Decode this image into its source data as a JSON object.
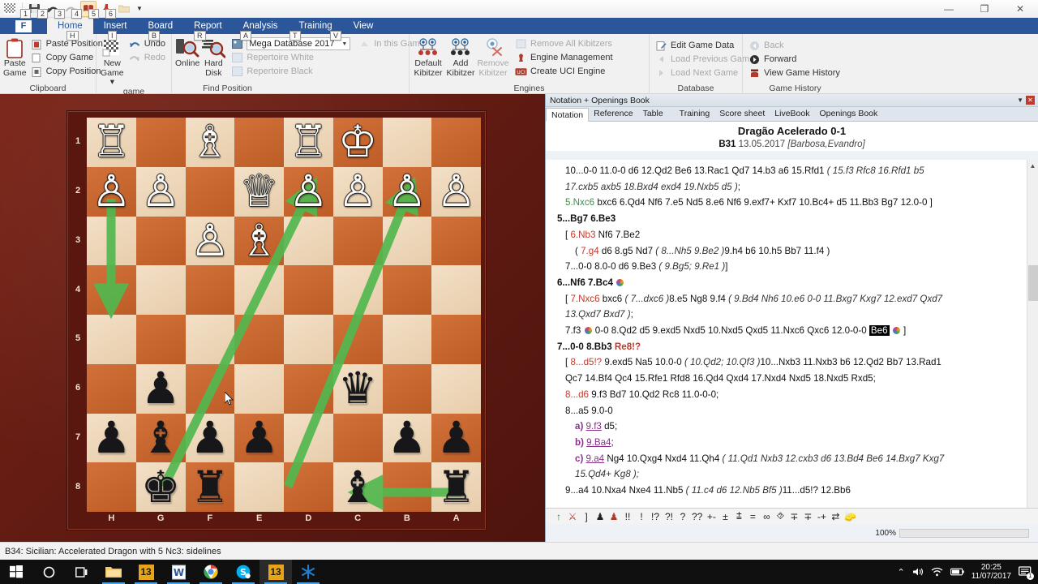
{
  "window": {
    "quick_access": [
      "board-icon",
      "save-icon",
      "undo-icon",
      "redo-icon",
      "book-icon",
      "pin-icon",
      "folder-icon"
    ],
    "quick_access_keytips": [
      "1",
      "2",
      "3",
      "4",
      "5",
      "6"
    ],
    "minimize": "—",
    "maximize": "❐",
    "close": "✕"
  },
  "ribbon": {
    "file_tab": "F",
    "tabs": [
      {
        "label": "Home",
        "keytip": "H",
        "active": true
      },
      {
        "label": "Insert",
        "keytip": "I",
        "active": false
      },
      {
        "label": "Board",
        "keytip": "B",
        "active": false
      },
      {
        "label": "Report",
        "keytip": "R",
        "active": false
      },
      {
        "label": "Analysis",
        "keytip": "A",
        "active": false
      },
      {
        "label": "Training",
        "keytip": "T",
        "active": false
      },
      {
        "label": "View",
        "keytip": "V",
        "active": false
      }
    ],
    "groups": [
      {
        "title": "Clipboard",
        "big": [
          {
            "label_line1": "Paste",
            "label_line2": "Game",
            "icon": "clipboard-icon"
          }
        ],
        "small": [
          {
            "label": "Paste Position",
            "icon": "paste-position-icon",
            "disabled": false
          },
          {
            "label": "Copy Game",
            "icon": "copy-game-icon",
            "disabled": false
          },
          {
            "label": "Copy Position",
            "icon": "copy-position-icon",
            "disabled": false
          }
        ]
      },
      {
        "title": "game",
        "big": [
          {
            "label_line1": "New",
            "label_line2": "Game ▾",
            "icon": "new-game-icon"
          }
        ],
        "small": [
          {
            "label": "Undo",
            "icon": "undo-icon",
            "disabled": false
          },
          {
            "label": "Redo",
            "icon": "redo-icon",
            "disabled": true
          }
        ]
      },
      {
        "title": "Find Position",
        "big": [
          {
            "label_line1": "Online",
            "label_line2": "",
            "icon": "online-search-icon"
          },
          {
            "label_line1": "Hard",
            "label_line2": "Disk",
            "icon": "harddisk-search-icon"
          }
        ],
        "combo": {
          "value": "Mega Database 2017",
          "icon": "database-icon"
        },
        "small": [
          {
            "label": "Repertoire White",
            "icon": "repertoire-white-icon",
            "disabled": true
          },
          {
            "label": "Repertoire Black",
            "icon": "repertoire-black-icon",
            "disabled": true
          },
          {
            "label": "In this Game",
            "icon": "in-this-game-icon",
            "disabled": true
          }
        ]
      },
      {
        "title": "Engines",
        "big": [
          {
            "label_line1": "Default",
            "label_line2": "Kibitzer",
            "icon": "default-kibitzer-icon"
          },
          {
            "label_line1": "Add",
            "label_line2": "Kibitzer",
            "icon": "add-kibitzer-icon"
          },
          {
            "label_line1": "Remove",
            "label_line2": "Kibitzer",
            "icon": "remove-kibitzer-icon",
            "disabled": true
          }
        ],
        "small": [
          {
            "label": "Remove All Kibitzers",
            "icon": "remove-all-kibitzers-icon",
            "disabled": true
          },
          {
            "label": "Engine Management",
            "icon": "engine-management-icon",
            "disabled": false
          },
          {
            "label": "Create UCI Engine",
            "icon": "create-uci-engine-icon",
            "disabled": false
          }
        ]
      },
      {
        "title": "Database",
        "small": [
          {
            "label": "Edit Game Data",
            "icon": "edit-game-data-icon",
            "disabled": false
          },
          {
            "label": "Load Previous Game",
            "icon": "load-previous-game-icon",
            "disabled": true
          },
          {
            "label": "Load Next Game",
            "icon": "load-next-game-icon",
            "disabled": true
          }
        ]
      },
      {
        "title": "Game History",
        "small": [
          {
            "label": "Back",
            "icon": "back-icon",
            "disabled": true
          },
          {
            "label": "Forward",
            "icon": "forward-icon",
            "disabled": false
          },
          {
            "label": "View Game History",
            "icon": "view-game-history-icon",
            "disabled": false
          }
        ]
      }
    ]
  },
  "board": {
    "orientation": "black-bottom-flipped",
    "rank_labels": [
      "1",
      "2",
      "3",
      "4",
      "5",
      "6",
      "7",
      "8"
    ],
    "file_labels": [
      "H",
      "G",
      "F",
      "E",
      "D",
      "C",
      "B",
      "A"
    ],
    "squares": [
      [
        "wR",
        "",
        "wB",
        "",
        "wR",
        "wK",
        "",
        ""
      ],
      [
        "wP",
        "wP",
        "",
        "wQ",
        "wP",
        "wP",
        "wP",
        "wP"
      ],
      [
        "",
        "",
        "wP",
        "wB",
        "",
        "",
        "",
        ""
      ],
      [
        "",
        "",
        "",
        "",
        "",
        "",
        "",
        ""
      ],
      [
        "",
        "",
        "",
        "",
        "",
        "",
        "",
        ""
      ],
      [
        "",
        "bP",
        "",
        "",
        "",
        "bQ",
        "",
        ""
      ],
      [
        "bP",
        "bB",
        "bP",
        "bP",
        "",
        "",
        "bP",
        "bP"
      ],
      [
        "",
        "bK",
        "bR",
        "",
        "",
        "bB",
        "",
        "bR"
      ]
    ],
    "arrows": [
      {
        "from": "h2",
        "to": "h4",
        "color": "#5cb85c",
        "label": "arrow-green-down-left-file"
      },
      {
        "from": "g7",
        "to": "b2",
        "color": "#5cb85c",
        "label": "arrow-green-long-diagonal-1"
      },
      {
        "from": "c6",
        "to": "a2",
        "color": "#5cb85c",
        "label": "arrow-green-long-diagonal-2"
      },
      {
        "from": "a8",
        "to": "c8",
        "color": "#5cb85c",
        "label": "arrow-green-rook-to-bishop"
      }
    ],
    "colors": {
      "light": "#efd9be",
      "dark": "#c8682f",
      "frame": "#5a1710"
    }
  },
  "notation_panel": {
    "caption": "Notation + Openings Book",
    "caption_buttons": [
      "chevron-down-icon",
      "close-icon"
    ],
    "tabs": [
      {
        "label": "Notation",
        "active": true
      },
      {
        "label": "Reference",
        "active": false
      },
      {
        "label": "Table",
        "active": false
      },
      {
        "label": "Training",
        "active": false
      },
      {
        "label": "Score sheet",
        "active": false
      },
      {
        "label": "LiveBook",
        "active": false
      },
      {
        "label": "Openings Book",
        "active": false
      }
    ],
    "game_title": "Dragão Acelerado  0-1",
    "eco": "B31",
    "date": "13.05.2017",
    "players": "[Barbosa,Evandro]",
    "lines": [
      {
        "indent": 1,
        "segments": [
          {
            "t": "10...0-0  11.0-0  d6  12.Qd2  Be6  13.Rac1  Qd7  14.b3  a6  15.Rfd1  ",
            "c": "plain"
          },
          {
            "t": "( 15.f3  Rfc8  16.Rfd1  b5",
            "c": "ital"
          }
        ]
      },
      {
        "indent": 1,
        "segments": [
          {
            "t": "17.cxb5  axb5  18.Bxd4  exd4  19.Nxb5  d5 )",
            "c": "ital"
          },
          {
            "t": ";",
            "c": "plain"
          }
        ]
      },
      {
        "indent": 1,
        "segments": [
          {
            "t": "5.Nxc6",
            "c": "green"
          },
          {
            "t": "  bxc6  6.Qd4  Nf6  7.e5  Nd5  8.e6  Nf6  9.exf7+  Kxf7  10.Bc4+  d5  11.Bb3  Bg7  12.0-0 ]",
            "c": "plain"
          }
        ]
      },
      {
        "indent": 0,
        "segments": [
          {
            "t": "5...Bg7  6.Be3",
            "c": "bold"
          }
        ]
      },
      {
        "indent": 1,
        "segments": [
          {
            "t": "[ ",
            "c": "plain"
          },
          {
            "t": "6.Nb3",
            "c": "red"
          },
          {
            "t": "  Nf6  7.Be2",
            "c": "plain"
          }
        ]
      },
      {
        "indent": 2,
        "segments": [
          {
            "t": "( ",
            "c": "plain"
          },
          {
            "t": "7.g4",
            "c": "red"
          },
          {
            "t": "  d6  8.g5  Nd7  ",
            "c": "plain"
          },
          {
            "t": "( 8...Nh5  9.Be2 )",
            "c": "ital"
          },
          {
            "t": "9.h4  b6  10.h5  Bb7  11.f4 )",
            "c": "plain"
          }
        ]
      },
      {
        "indent": 1,
        "segments": [
          {
            "t": "7...0-0  8.0-0  d6  9.Be3  ",
            "c": "plain"
          },
          {
            "t": "( 9.Bg5; 9.Re1 )",
            "c": "ital"
          },
          {
            "t": "]",
            "c": "plain"
          }
        ]
      },
      {
        "indent": 0,
        "segments": [
          {
            "t": "6...Nf6  7.Bc4  ",
            "c": "bold"
          },
          {
            "t": "◌",
            "c": "medal"
          }
        ]
      },
      {
        "indent": 1,
        "segments": [
          {
            "t": "[ ",
            "c": "plain"
          },
          {
            "t": "7.Nxc6",
            "c": "red"
          },
          {
            "t": "  bxc6  ",
            "c": "plain"
          },
          {
            "t": "( 7...dxc6 )",
            "c": "ital"
          },
          {
            "t": "8.e5  Ng8  9.f4  ",
            "c": "plain"
          },
          {
            "t": "( 9.Bd4  Nh6  10.e6  0-0  11.Bxg7  Kxg7  12.exd7  Qxd7",
            "c": "ital"
          }
        ]
      },
      {
        "indent": 1,
        "segments": [
          {
            "t": "13.Qxd7  Bxd7 )",
            "c": "ital"
          },
          {
            "t": ";",
            "c": "plain"
          }
        ]
      },
      {
        "indent": 1,
        "segments": [
          {
            "t": "7.f3  ",
            "c": "plain"
          },
          {
            "t": "◌",
            "c": "medal"
          },
          {
            "t": "  0-0  8.Qd2  d5  9.exd5  Nxd5  10.Nxd5  Qxd5  11.Nxc6  Qxc6  12.0-0-0  ",
            "c": "plain"
          },
          {
            "t": "Be6",
            "c": "hl"
          },
          {
            "t": " ",
            "c": "plain"
          },
          {
            "t": "◌",
            "c": "medal"
          },
          {
            "t": " ]",
            "c": "plain"
          }
        ]
      },
      {
        "indent": 0,
        "segments": [
          {
            "t": "7...0-0  8.Bb3  ",
            "c": "bold"
          },
          {
            "t": "Re8!?",
            "c": "redb"
          }
        ]
      },
      {
        "indent": 1,
        "segments": [
          {
            "t": "[ ",
            "c": "plain"
          },
          {
            "t": "8...d5!?",
            "c": "red"
          },
          {
            "t": "  9.exd5  Na5  10.0-0  ",
            "c": "plain"
          },
          {
            "t": "( 10.Qd2; 10.Qf3 )",
            "c": "ital"
          },
          {
            "t": "10...Nxb3  11.Nxb3  b6  12.Qd2  Bb7  13.Rad1",
            "c": "plain"
          }
        ]
      },
      {
        "indent": 1,
        "segments": [
          {
            "t": "Qc7  14.Bf4  Qc4  15.Rfe1  Rfd8  16.Qd4  Qxd4  17.Nxd4  Nxd5  18.Nxd5  Rxd5;",
            "c": "plain"
          }
        ]
      },
      {
        "indent": 1,
        "segments": [
          {
            "t": "8...d6",
            "c": "red"
          },
          {
            "t": "  9.f3  Bd7  10.Qd2  Rc8  11.0-0-0;",
            "c": "plain"
          }
        ]
      },
      {
        "indent": 1,
        "segments": [
          {
            "t": "8...a5  9.0-0",
            "c": "plain"
          }
        ]
      },
      {
        "indent": 2,
        "segments": [
          {
            "t": "a) ",
            "c": "purpleb"
          },
          {
            "t": "9.f3",
            "c": "purple"
          },
          {
            "t": "  d5;",
            "c": "plain"
          }
        ]
      },
      {
        "indent": 2,
        "segments": [
          {
            "t": "b) ",
            "c": "purpleb"
          },
          {
            "t": "9.Ba4",
            "c": "purple"
          },
          {
            "t": ";",
            "c": "plain"
          }
        ]
      },
      {
        "indent": 2,
        "segments": [
          {
            "t": "c) ",
            "c": "purpleb"
          },
          {
            "t": "9.a4",
            "c": "purple"
          },
          {
            "t": "  Ng4  10.Qxg4  Nxd4  11.Qh4  ",
            "c": "plain"
          },
          {
            "t": "( 11.Qd1  Nxb3  12.cxb3  d6  13.Bd4  Be6  14.Bxg7  Kxg7",
            "c": "ital"
          }
        ]
      },
      {
        "indent": 2,
        "segments": [
          {
            "t": "15.Qd4+  Kg8 );",
            "c": "ital"
          }
        ]
      },
      {
        "indent": 1,
        "segments": [
          {
            "t": "9...a4  10.Nxa4  Nxe4  11.Nb5  ",
            "c": "plain"
          },
          {
            "t": "( 11.c4  d6  12.Nb5  Bf5 )",
            "c": "ital"
          },
          {
            "t": "11...d5!?  12.Bb6",
            "c": "plain"
          }
        ]
      }
    ],
    "symbols": [
      "↑",
      "⚔",
      "]",
      "♟",
      "♟",
      "!!",
      "!",
      "!?",
      "?!",
      "?",
      "??",
      "+-",
      "±",
      "⩲",
      "=",
      "∞",
      "⯑",
      "∓",
      "∓",
      "-+",
      "⇄",
      "🧽"
    ],
    "progress": {
      "label": "100%",
      "percent": 100
    }
  },
  "statusbar": {
    "text": "B34: Sicilian: Accelerated Dragon with 5 Nc3: sidelines"
  },
  "taskbar": {
    "items": [
      {
        "name": "start-button",
        "glyph": "⊞"
      },
      {
        "name": "cortana-search",
        "glyph": "◯"
      },
      {
        "name": "task-view",
        "glyph": "❐"
      },
      {
        "name": "file-explorer",
        "glyph": "📁"
      },
      {
        "name": "chessbase-13-a",
        "glyph": "13"
      },
      {
        "name": "word",
        "glyph": "W"
      },
      {
        "name": "chrome",
        "glyph": "◉"
      },
      {
        "name": "skype",
        "glyph": "S"
      },
      {
        "name": "chessbase-13-b",
        "glyph": "13"
      },
      {
        "name": "other-app",
        "glyph": "✻"
      }
    ],
    "tray": {
      "chevron": "⌃",
      "volume": "🔊",
      "wifi": "📶",
      "battery": "▭",
      "time": "20:25",
      "date": "11/07/2017",
      "notifications": "🗨",
      "badge": "1"
    }
  }
}
